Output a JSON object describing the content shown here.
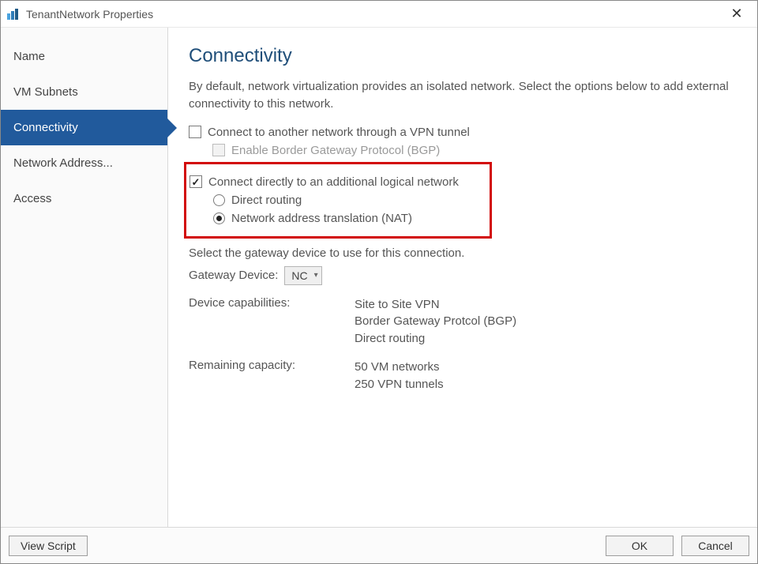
{
  "window": {
    "title": "TenantNetwork Properties"
  },
  "sidebar": {
    "items": [
      {
        "label": "Name"
      },
      {
        "label": "VM Subnets"
      },
      {
        "label": "Connectivity"
      },
      {
        "label": "Network Address..."
      },
      {
        "label": "Access"
      }
    ],
    "selected_index": 2
  },
  "page": {
    "heading": "Connectivity",
    "intro": "By default, network virtualization provides an isolated network. Select the options below to add external connectivity to this network.",
    "vpn": {
      "label": "Connect to another network through a VPN tunnel",
      "checked": false,
      "bgp_label": "Enable Border Gateway Protocol (BGP)",
      "bgp_checked": false
    },
    "direct": {
      "label": "Connect directly to an additional logical network",
      "checked": true,
      "routing_label": "Direct routing",
      "nat_label": "Network address translation (NAT)",
      "selected": "nat"
    },
    "gateway_prompt": "Select the gateway device to use for this connection.",
    "gateway_label": "Gateway Device:",
    "gateway_value": "NC",
    "caps_label": "Device capabilities:",
    "caps": [
      "Site to Site VPN",
      "Border Gateway Protcol (BGP)",
      "Direct routing"
    ],
    "remaining_label": "Remaining capacity:",
    "remaining": [
      "50 VM networks",
      "250 VPN tunnels"
    ]
  },
  "footer": {
    "view_script": "View Script",
    "ok": "OK",
    "cancel": "Cancel"
  }
}
